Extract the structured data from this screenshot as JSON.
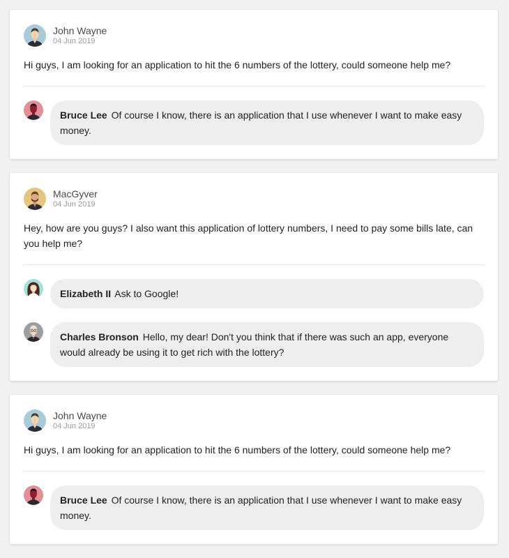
{
  "posts": [
    {
      "author": "John Wayne",
      "date": "04 Jun 2019",
      "avatar_icon": "john-wayne-avatar-icon",
      "text": "Hi guys, I am looking for an application to hit the 6 numbers of the lottery, could someone help me?",
      "comments": [
        {
          "author": "Bruce Lee",
          "avatar_icon": "bruce-lee-avatar-icon",
          "text": "Of course I know, there is an application that I use whenever I want to make easy money."
        }
      ]
    },
    {
      "author": "MacGyver",
      "date": "04 Jun 2019",
      "avatar_icon": "macgyver-avatar-icon",
      "text": "Hey, how are you guys? I also want this application of lottery numbers, I need to pay some bills late, can you help me?",
      "comments": [
        {
          "author": "Elizabeth II",
          "avatar_icon": "elizabeth-ii-avatar-icon",
          "text": "Ask to Google!"
        },
        {
          "author": "Charles Bronson",
          "avatar_icon": "charles-bronson-avatar-icon",
          "text": "Hello, my dear! Don't you think that if there was such an app, everyone would already be using it to get rich with the lottery?"
        }
      ]
    },
    {
      "author": "John Wayne",
      "date": "04 Jun 2019",
      "avatar_icon": "john-wayne-avatar-icon",
      "text": "Hi guys, I am looking for an application to hit the 6 numbers of the lottery, could someone help me?",
      "comments": [
        {
          "author": "Bruce Lee",
          "avatar_icon": "bruce-lee-avatar-icon",
          "text": "Of course I know, there is an application that I use whenever I want to make easy money."
        }
      ]
    }
  ],
  "colors": {
    "page_background": "#f1f1f1",
    "card_background": "#ffffff",
    "bubble_background": "#eeeeee",
    "date_text": "#9a9a9a"
  }
}
